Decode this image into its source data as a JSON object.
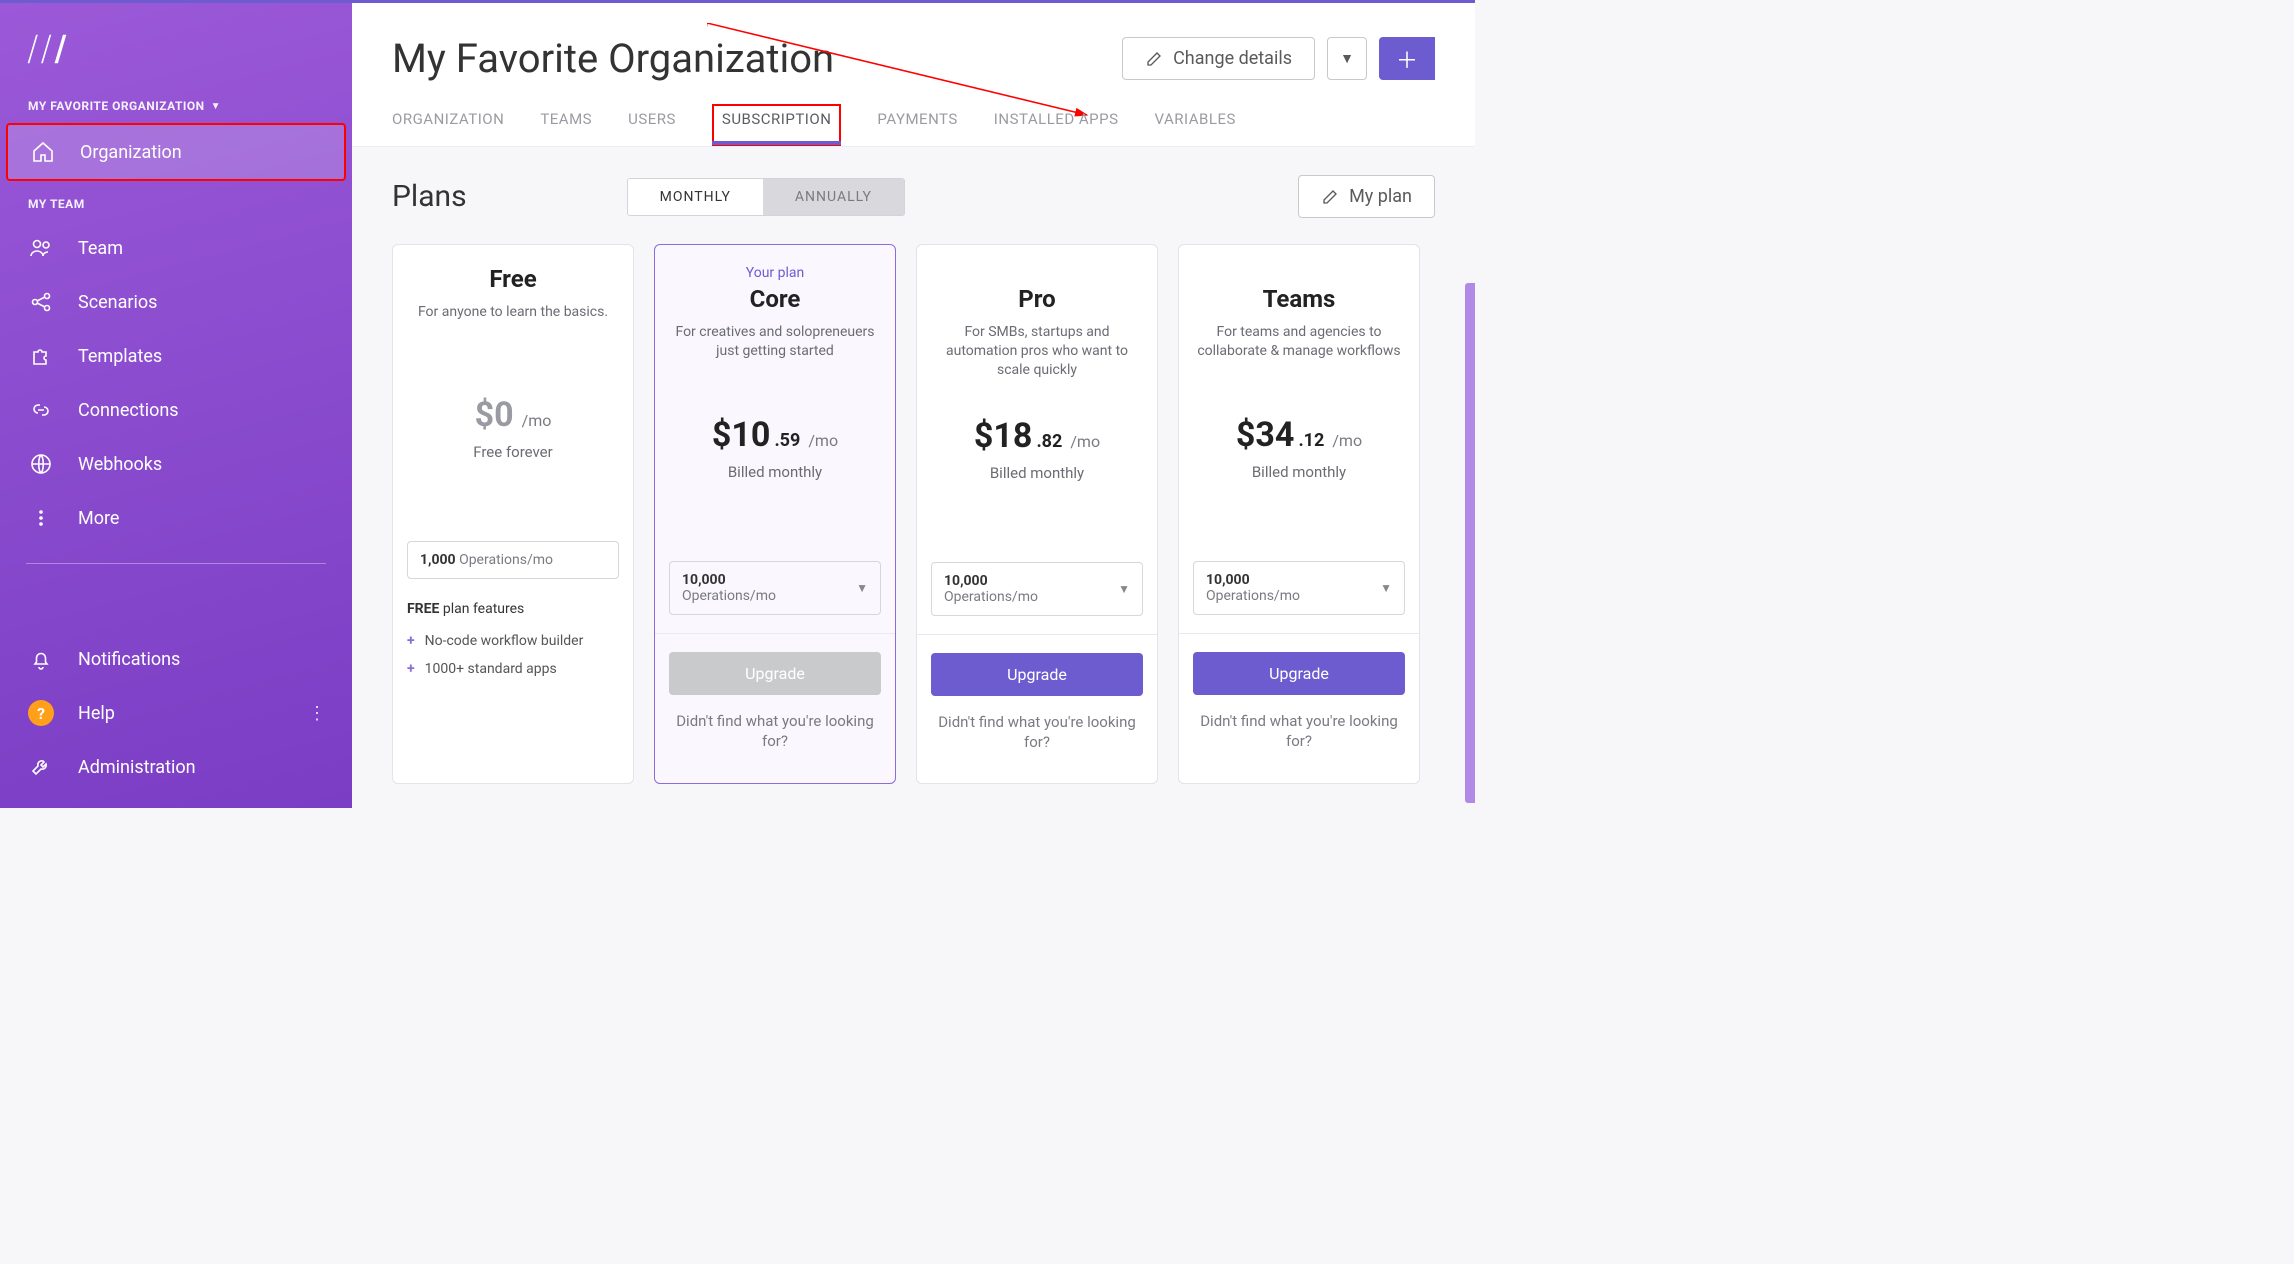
{
  "sidebar": {
    "org_label": "MY FAVORITE ORGANIZATION",
    "org_item": "Organization",
    "team_label": "MY TEAM",
    "items": [
      {
        "label": "Team"
      },
      {
        "label": "Scenarios"
      },
      {
        "label": "Templates"
      },
      {
        "label": "Connections"
      },
      {
        "label": "Webhooks"
      },
      {
        "label": "More"
      }
    ],
    "bottom": [
      {
        "label": "Notifications"
      },
      {
        "label": "Help"
      },
      {
        "label": "Administration"
      }
    ]
  },
  "header": {
    "title": "My Favorite Organization",
    "change_details": "Change details"
  },
  "tabs": [
    {
      "label": "ORGANIZATION"
    },
    {
      "label": "TEAMS"
    },
    {
      "label": "USERS"
    },
    {
      "label": "SUBSCRIPTION"
    },
    {
      "label": "PAYMENTS"
    },
    {
      "label": "INSTALLED APPS"
    },
    {
      "label": "VARIABLES"
    }
  ],
  "content": {
    "plans_title": "Plans",
    "toggle_monthly": "MONTHLY",
    "toggle_annually": "ANNUALLY",
    "my_plan": "My plan"
  },
  "plans": [
    {
      "your_plan": "",
      "name": "Free",
      "sub": "For anyone to learn the basics.",
      "price_main": "$0",
      "price_cents": "",
      "price_unit": "/mo",
      "price_note": "Free forever",
      "ops_num": "1,000",
      "ops_label": "Operations/mo",
      "has_dropdown": false,
      "feat_head_bold": "FREE",
      "feat_head_rest": " plan features",
      "features": [
        "No-code workflow builder",
        "1000+ standard apps"
      ],
      "upgrade_label": "",
      "notfound": ""
    },
    {
      "your_plan": "Your plan",
      "name": "Core",
      "sub": "For creatives and solopreneuers just getting started",
      "price_main": "$10",
      "price_cents": ".59",
      "price_unit": "/mo",
      "price_note": "Billed monthly",
      "ops_num": "10,000",
      "ops_label": "Operations/mo",
      "has_dropdown": true,
      "feat_head_bold": "",
      "feat_head_rest": "",
      "features": [],
      "upgrade_label": "Upgrade",
      "upgrade_disabled": true,
      "notfound": "Didn't find what you're looking for?"
    },
    {
      "your_plan": "",
      "name": "Pro",
      "sub": "For SMBs, startups and automation pros who want to scale quickly",
      "price_main": "$18",
      "price_cents": ".82",
      "price_unit": "/mo",
      "price_note": "Billed monthly",
      "ops_num": "10,000",
      "ops_label": "Operations/mo",
      "has_dropdown": true,
      "feat_head_bold": "",
      "feat_head_rest": "",
      "features": [],
      "upgrade_label": "Upgrade",
      "upgrade_disabled": false,
      "notfound": "Didn't find what you're looking for?"
    },
    {
      "your_plan": "",
      "name": "Teams",
      "sub": "For teams and agencies to collaborate & manage workflows",
      "price_main": "$34",
      "price_cents": ".12",
      "price_unit": "/mo",
      "price_note": "Billed monthly",
      "ops_num": "10,000",
      "ops_label": "Operations/mo",
      "has_dropdown": true,
      "feat_head_bold": "",
      "feat_head_rest": "",
      "features": [],
      "upgrade_label": "Upgrade",
      "upgrade_disabled": false,
      "notfound": "Didn't find what you're looking for?"
    }
  ]
}
